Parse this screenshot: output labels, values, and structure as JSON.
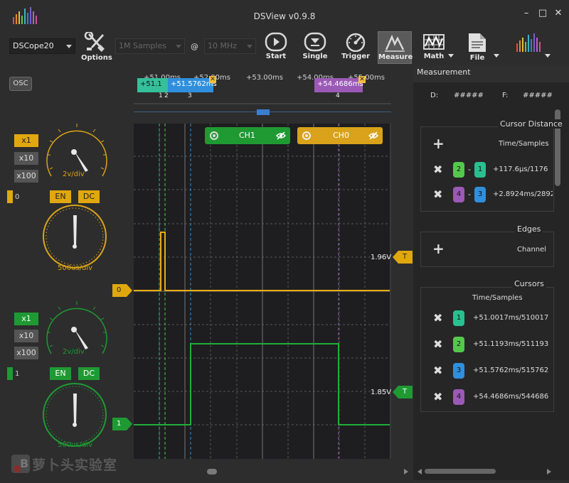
{
  "app": {
    "title": "DSView v0.9.8"
  },
  "window_buttons": {
    "minimize": "–",
    "maximize": "□",
    "close": "✕"
  },
  "toolbar": {
    "device": "DSCope20",
    "samples": "1M Samples",
    "at_symbol": "@",
    "rate": "10 MHz",
    "options_label": "Options",
    "start_label": "Start",
    "single_label": "Single",
    "trigger_label": "Trigger",
    "measure_label": "Measure",
    "math_label": "Math",
    "file_label": "File"
  },
  "mode": {
    "osc_label": "OSC"
  },
  "ruler": {
    "ticks": [
      "+51.00ms",
      "+52.00ms",
      "+53.00ms",
      "+54.00ms",
      "+55.00ms"
    ],
    "flag1_text": "+51.1",
    "flag1_num": "1",
    "flag1_num2": "2",
    "flag2_text": "+51.5762ms",
    "flag2_num": "3",
    "flag3_text": "+54.4686ms",
    "flag3_num": "4",
    "close_x": "✕"
  },
  "channels": {
    "ch1": {
      "label": "CH1",
      "scale_x1": "x1",
      "scale_x10": "x10",
      "scale_x100": "x100",
      "vdiv": "2v/div",
      "index": "1",
      "en": "EN",
      "dc": "DC",
      "marker": "1",
      "trigger_level": "1.85V",
      "trigger_tag": "T",
      "color": "#1f9a33"
    },
    "ch0": {
      "label": "CH0",
      "scale_x1": "x1",
      "scale_x10": "x10",
      "scale_x100": "x100",
      "vdiv": "2v/div",
      "index": "0",
      "en": "EN",
      "dc": "DC",
      "marker": "0",
      "trigger_level": "1.96V",
      "trigger_tag": "T",
      "color": "#e0a80e"
    }
  },
  "timebase": {
    "yellow_dial": "500us/div",
    "green_dial": "500us/div"
  },
  "panel": {
    "title": "Measurement",
    "d_label": "D:",
    "d_value": "#####",
    "f_label": "F:",
    "f_value": "#####",
    "cursor_distance": {
      "title": "Cursor Distance",
      "header": "Time/Samples",
      "rows": [
        {
          "a": "2",
          "b": "1",
          "value": "+117.6µs/1176"
        },
        {
          "a": "4",
          "b": "3",
          "value": "+2.8924ms/28924"
        }
      ]
    },
    "edges": {
      "title": "Edges",
      "header": "Channel"
    },
    "cursors": {
      "title": "Cursors",
      "header": "Time/Samples",
      "rows": [
        {
          "num": "1",
          "value": "+51.0017ms/510017"
        },
        {
          "num": "2",
          "value": "+51.1193ms/511193"
        },
        {
          "num": "3",
          "value": "+51.5762ms/515762"
        },
        {
          "num": "4",
          "value": "+54.4686ms/544686"
        }
      ]
    },
    "plus": "+",
    "remove": "✖",
    "minus": "-"
  },
  "watermark": {
    "text": "萝卜头实验室",
    "logo_letter": "B"
  },
  "icons": [
    "app-logo-icon",
    "options-icon",
    "start-icon",
    "single-icon",
    "trigger-icon",
    "measure-icon",
    "math-icon",
    "file-icon",
    "color-bars-icon",
    "gear-icon",
    "eye-icon"
  ]
}
